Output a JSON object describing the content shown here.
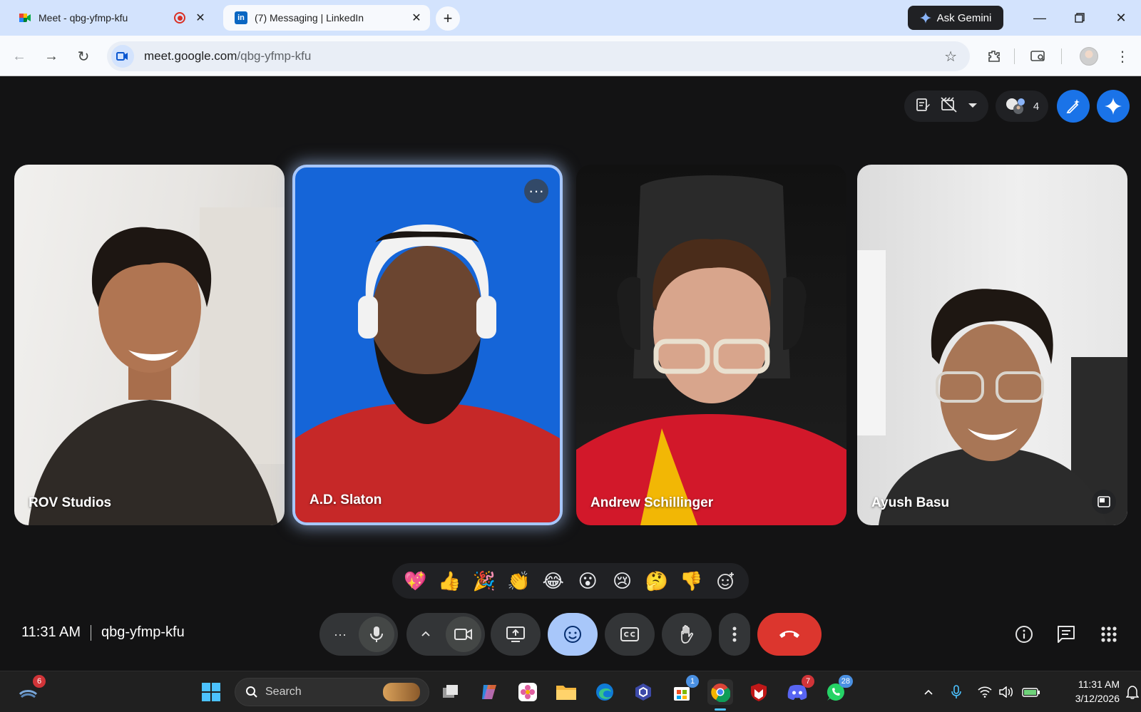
{
  "browser": {
    "tabs": [
      {
        "title": "Meet - qbg-yfmp-kfu",
        "recording": true
      },
      {
        "title": "(7) Messaging | LinkedIn",
        "active": true
      }
    ],
    "ask_gemini_label": "Ask Gemini",
    "url_host": "meet.google.com",
    "url_path": "/qbg-yfmp-kfu"
  },
  "meet": {
    "participant_count": "4",
    "tiles": [
      {
        "name": "ROV Studios"
      },
      {
        "name": "A.D. Slaton",
        "active_speaker": true
      },
      {
        "name": "Andrew Schillinger"
      },
      {
        "name": "Ayush Basu"
      }
    ],
    "reactions": [
      "💖",
      "👍",
      "🎉",
      "👏",
      "😂",
      "😮",
      "😢",
      "🤔",
      "👎"
    ],
    "time": "11:31 AM",
    "meeting_code": "qbg-yfmp-kfu",
    "colors": {
      "accent": "#a8c7fa",
      "end_call": "#dc362e",
      "active_tile_bg": "#1565d8"
    }
  },
  "taskbar": {
    "search_placeholder": "Search",
    "badges": {
      "widgets": "6",
      "store": "1",
      "discord": "7",
      "whatsapp": "28"
    },
    "clock_time": "11:31 AM",
    "clock_date": "3/12/2026"
  }
}
